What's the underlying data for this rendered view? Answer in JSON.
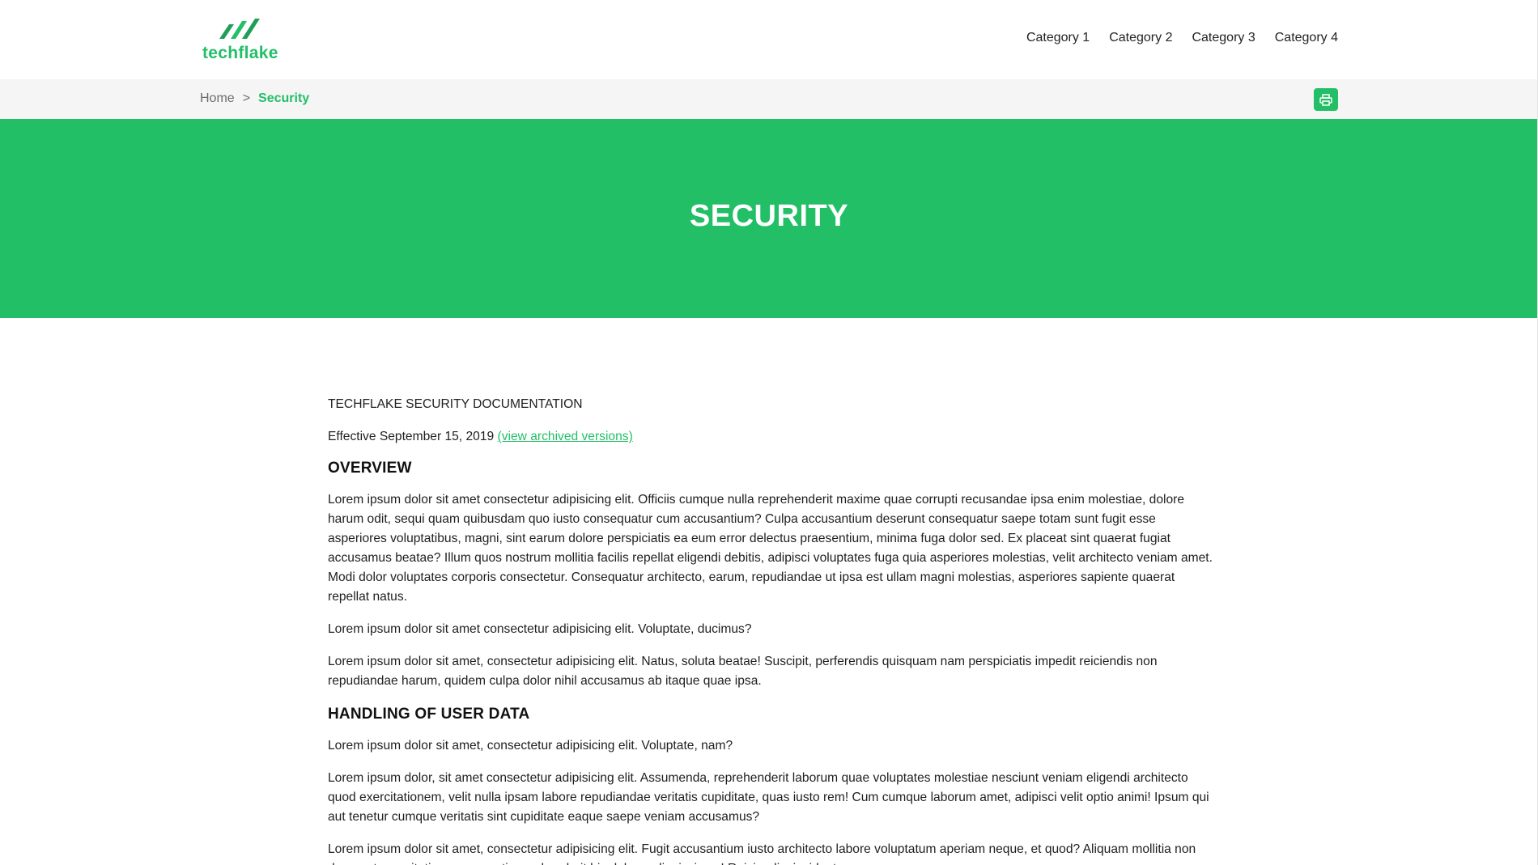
{
  "brand": {
    "name": "techflake",
    "accent_color": "#22bf67",
    "logo_icon": "techflake-logo-icon"
  },
  "nav": {
    "items": [
      {
        "label": "Category 1"
      },
      {
        "label": "Category 2"
      },
      {
        "label": "Category 3"
      },
      {
        "label": "Category 4"
      }
    ]
  },
  "breadcrumb": {
    "home": "Home",
    "separator": ">",
    "current": "Security"
  },
  "print_button": {
    "icon": "printer-icon"
  },
  "hero": {
    "title": "SECURITY"
  },
  "content": {
    "doc_title": "TECHFLAKE SECURITY DOCUMENTATION",
    "effective_text": "Effective September 15, 2019",
    "archived_link": "(view archived versions)",
    "sections": [
      {
        "heading": "OVERVIEW",
        "paragraphs": [
          "Lorem ipsum dolor sit amet consectetur adipisicing elit. Officiis cumque nulla reprehenderit maxime quae corrupti recusandae ipsa enim molestiae, dolore harum odit, sequi quam quibusdam quo iusto consequatur cum accusantium? Culpa accusantium deserunt consequatur saepe totam sunt fugit esse asperiores voluptatibus, magni, sint earum dolore perspiciatis ea eum error delectus praesentium, minima fuga dolor sed. Ex placeat sint quaerat fugiat accusamus beatae? Illum quos nostrum mollitia facilis repellat eligendi debitis, adipisci voluptates fuga quia asperiores molestias, velit architecto veniam amet. Modi dolor voluptates corporis consectetur. Consequatur architecto, earum, repudiandae ut ipsa est ullam magni molestias, asperiores sapiente quaerat repellat natus.",
          "Lorem ipsum dolor sit amet consectetur adipisicing elit. Voluptate, ducimus?",
          "Lorem ipsum dolor sit amet, consectetur adipisicing elit. Natus, soluta beatae! Suscipit, perferendis quisquam nam perspiciatis impedit reiciendis non repudiandae harum, quidem culpa dolor nihil accusamus ab itaque quae ipsa."
        ]
      },
      {
        "heading": "HANDLING OF USER DATA",
        "paragraphs": [
          "Lorem ipsum dolor sit amet, consectetur adipisicing elit. Voluptate, nam?",
          "Lorem ipsum dolor, sit amet consectetur adipisicing elit. Assumenda, reprehenderit laborum quae voluptates molestiae nesciunt veniam eligendi architecto quod exercitationem, velit nulla ipsam labore repudiandae veritatis cupiditate, quas iusto rem! Cum cumque laborum amet, adipisci velit optio animi! Ipsum qui aut tenetur cumque veritatis sint cupiditate eaque saepe veniam accusamus?",
          "Lorem ipsum dolor sit amet, consectetur adipisicing elit. Fugit accusantium iusto architecto labore voluptatum aperiam neque, et quod? Aliquam mollitia non deserunt exercitationem corrupti reprehenderit hic dolores dignissimos! Reiciendis, incidunt."
        ]
      }
    ]
  }
}
